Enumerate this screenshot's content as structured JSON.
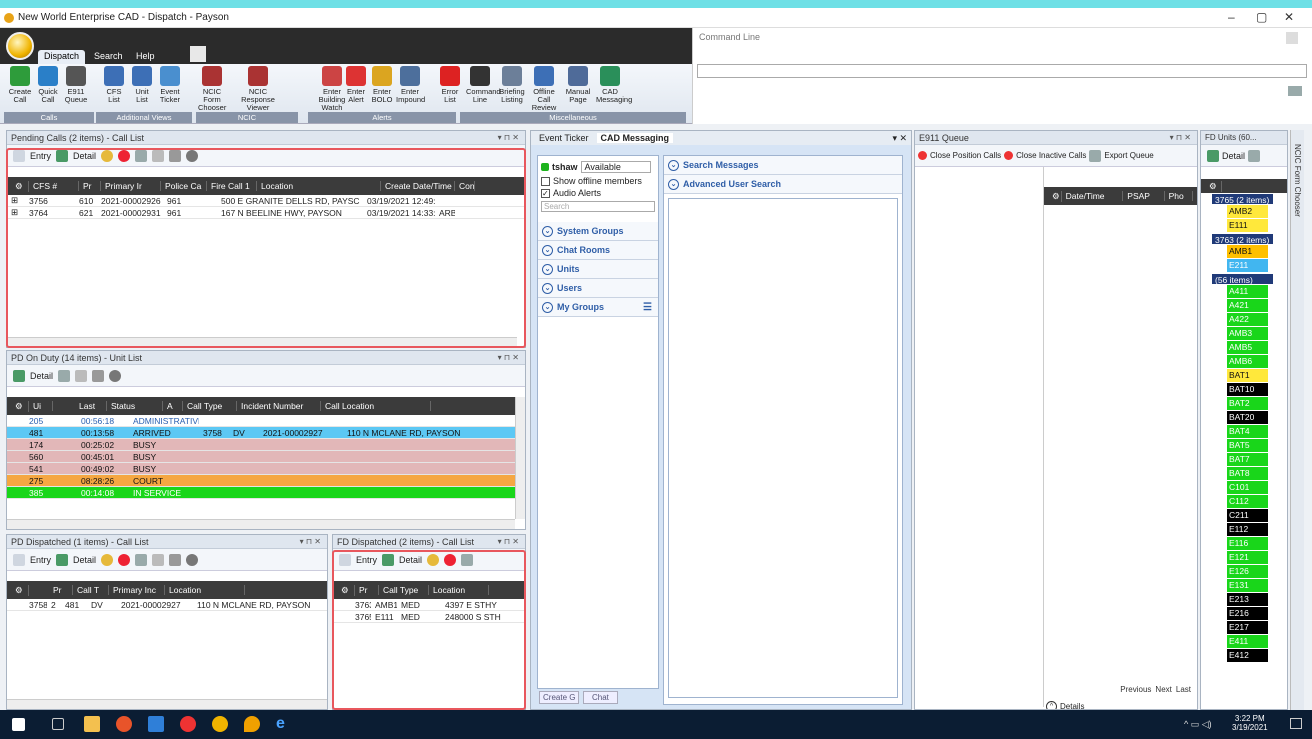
{
  "window": {
    "title": "New World Enterprise CAD - Dispatch - Payson",
    "min": "–",
    "max": "▢",
    "close": "✕"
  },
  "ribbon": {
    "tabs": [
      "Dispatch",
      "Search",
      "Help"
    ],
    "buttons": [
      {
        "label": "Create\nCall",
        "color": "#2e9c3b"
      },
      {
        "label": "Quick\nCall",
        "color": "#2a7fc8"
      },
      {
        "label": "E911\nQueue",
        "color": "#555"
      },
      {
        "label": "CFS\nList",
        "color": "#3d6fb6"
      },
      {
        "label": "Unit\nList",
        "color": "#3d6fb6"
      },
      {
        "label": "Event\nTicker",
        "color": "#4a8fcf"
      },
      {
        "label": "NCIC Form\nChooser",
        "color": "#a33"
      },
      {
        "label": "NCIC Response\nViewer",
        "color": "#a33"
      },
      {
        "label": "Enter Building\nWatch",
        "color": "#c44"
      },
      {
        "label": "Enter\nAlert",
        "color": "#d33"
      },
      {
        "label": "Enter\nBOLO",
        "color": "#dba520"
      },
      {
        "label": "Enter\nImpound",
        "color": "#4d6f9c"
      },
      {
        "label": "Error\nList",
        "color": "#d22"
      },
      {
        "label": "Command\nLine",
        "color": "#333"
      },
      {
        "label": "Briefing\nListing",
        "color": "#6c7f99"
      },
      {
        "label": "Offline Call\nReview",
        "color": "#3d6fb6"
      },
      {
        "label": "Manual\nPage",
        "color": "#4f6b99"
      },
      {
        "label": "CAD\nMessaging",
        "color": "#2a8f5a"
      }
    ],
    "groups": [
      "Calls",
      "Additional Views",
      "NCIC",
      "Alerts",
      "Miscellaneous"
    ]
  },
  "command_line": {
    "label": "Command Line"
  },
  "pending": {
    "title": "Pending Calls (2 items) - Call List",
    "toolbar": [
      "Entry",
      "Detail"
    ],
    "headers": [
      "CFS #",
      "Pr",
      "Primary Ir",
      "Police Ca",
      "Fire Call 1",
      "Location",
      "Create Date/Time",
      "Con"
    ],
    "rows": [
      [
        "3756",
        "610",
        "2021-00002926",
        "961",
        "",
        "500 E GRANITE DELLS RD, PAYSC",
        "03/19/2021 12:49:14",
        ""
      ],
      [
        "3764",
        "621",
        "2021-00002931",
        "961",
        "",
        "167 N BEELINE HWY, PAYSON",
        "03/19/2021 14:33:54",
        "ARBY"
      ]
    ]
  },
  "pd_duty": {
    "title": "PD On Duty (14 items) - Unit List",
    "toolbar": [
      "Detail"
    ],
    "headers": [
      "Ui",
      "",
      "Last",
      "Status",
      "A",
      "Call Type",
      "Incident Number",
      "Call Location"
    ],
    "rows": [
      {
        "cells": [
          "205",
          "00:56:18",
          "ADMINISTRATIVE",
          "",
          "",
          "",
          ""
        ],
        "bg": "#ffffff",
        "fg": "#2a5fb0"
      },
      {
        "cells": [
          "481",
          "00:13:58",
          "ARRIVED",
          "3758",
          "DV",
          "2021-00002927",
          "110 N MCLANE RD, PAYSON"
        ],
        "bg": "#5cc8f4",
        "fg": "#111"
      },
      {
        "cells": [
          "174",
          "00:25:02",
          "BUSY",
          "",
          "",
          "",
          ""
        ],
        "bg": "#e2b7b8",
        "fg": "#111"
      },
      {
        "cells": [
          "560",
          "00:45:01",
          "BUSY",
          "",
          "",
          "",
          ""
        ],
        "bg": "#e2b7b8",
        "fg": "#111"
      },
      {
        "cells": [
          "541",
          "00:49:02",
          "BUSY",
          "",
          "",
          "",
          ""
        ],
        "bg": "#e2b7b8",
        "fg": "#111"
      },
      {
        "cells": [
          "275",
          "08:28:26",
          "COURT",
          "",
          "",
          "",
          ""
        ],
        "bg": "#f5a742",
        "fg": "#111"
      },
      {
        "cells": [
          "385",
          "00:14:08",
          "IN SERVICE",
          "",
          "",
          "",
          ""
        ],
        "bg": "#19d61a",
        "fg": "#fff"
      }
    ]
  },
  "pd_disp": {
    "title": "PD Dispatched (1 items) - Call List",
    "toolbar": [
      "Entry",
      "Detail"
    ],
    "headers": [
      "",
      "Pr",
      "Call T",
      "Primary Inc",
      "Location"
    ],
    "rows": [
      [
        "3758",
        "2",
        "481",
        "DV",
        "2021-00002927",
        "110 N MCLANE RD, PAYSON"
      ]
    ]
  },
  "fd_disp": {
    "title": "FD Dispatched (2 items) - Call List",
    "toolbar": [
      "Entry",
      "Detail"
    ],
    "headers": [
      "Pr",
      "Call Type",
      "Location"
    ],
    "rows": [
      [
        "3763",
        "AMB1",
        "MED",
        "4397 E STHY"
      ],
      [
        "3765",
        "E111",
        "MED",
        "248000 S STH"
      ]
    ]
  },
  "center": {
    "tabs": [
      "Event Ticker",
      "CAD Messaging"
    ],
    "user": "tshaw",
    "status": "Available",
    "show_offline": "Show offline members",
    "audio_alerts": "Audio Alerts",
    "search_ph": "Search",
    "sections": [
      "System Groups",
      "Chat Rooms",
      "Units",
      "Users",
      "My Groups"
    ],
    "search_messages": "Search Messages",
    "advanced_search": "Advanced User Search",
    "btn_create": "Create G",
    "btn_chat": "Chat"
  },
  "e911": {
    "title": "E911 Queue",
    "close_pos": "Close Position Calls",
    "close_inactive": "Close Inactive Calls",
    "export": "Export Queue",
    "headers": [
      "Date/Time",
      "PSAP",
      "Pho"
    ],
    "prev": "Previous",
    "next": "Next",
    "last": "Last",
    "details": "Details"
  },
  "fd_units": {
    "title": "FD Units (60...",
    "detail": "Detail",
    "side_tab": "NCIC Form Chooser",
    "groups": [
      {
        "label": "3765 (2 items)",
        "units": [
          {
            "n": "AMB2",
            "bg": "#ffe83b",
            "fg": "#111"
          },
          {
            "n": "E111",
            "bg": "#ffe83b",
            "fg": "#111"
          }
        ]
      },
      {
        "label": "3763 (2 items)",
        "units": [
          {
            "n": "AMB1",
            "bg": "#ffc000",
            "fg": "#111"
          },
          {
            "n": "E211",
            "bg": "#41b6f0",
            "fg": "#fff"
          }
        ]
      },
      {
        "label": "(56 items)",
        "units": [
          {
            "n": "A411",
            "bg": "#19d61a",
            "fg": "#fff"
          },
          {
            "n": "A421",
            "bg": "#19d61a",
            "fg": "#fff"
          },
          {
            "n": "A422",
            "bg": "#19d61a",
            "fg": "#fff"
          },
          {
            "n": "AMB3",
            "bg": "#19d61a",
            "fg": "#fff"
          },
          {
            "n": "AMB5",
            "bg": "#19d61a",
            "fg": "#fff"
          },
          {
            "n": "AMB6",
            "bg": "#19d61a",
            "fg": "#fff"
          },
          {
            "n": "BAT1",
            "bg": "#ffe83b",
            "fg": "#111"
          },
          {
            "n": "BAT10",
            "bg": "#000",
            "fg": "#fff"
          },
          {
            "n": "BAT2",
            "bg": "#19d61a",
            "fg": "#fff"
          },
          {
            "n": "BAT20",
            "bg": "#000",
            "fg": "#fff"
          },
          {
            "n": "BAT4",
            "bg": "#19d61a",
            "fg": "#fff"
          },
          {
            "n": "BAT5",
            "bg": "#19d61a",
            "fg": "#fff"
          },
          {
            "n": "BAT7",
            "bg": "#19d61a",
            "fg": "#fff"
          },
          {
            "n": "BAT8",
            "bg": "#19d61a",
            "fg": "#fff"
          },
          {
            "n": "C101",
            "bg": "#19d61a",
            "fg": "#fff"
          },
          {
            "n": "C112",
            "bg": "#19d61a",
            "fg": "#fff"
          },
          {
            "n": "C211",
            "bg": "#000",
            "fg": "#fff"
          },
          {
            "n": "E112",
            "bg": "#000",
            "fg": "#fff"
          },
          {
            "n": "E116",
            "bg": "#19d61a",
            "fg": "#fff"
          },
          {
            "n": "E121",
            "bg": "#19d61a",
            "fg": "#fff"
          },
          {
            "n": "E126",
            "bg": "#19d61a",
            "fg": "#fff"
          },
          {
            "n": "E131",
            "bg": "#19d61a",
            "fg": "#fff"
          },
          {
            "n": "E213",
            "bg": "#000",
            "fg": "#fff"
          },
          {
            "n": "E216",
            "bg": "#000",
            "fg": "#fff"
          },
          {
            "n": "E217",
            "bg": "#000",
            "fg": "#fff"
          },
          {
            "n": "E411",
            "bg": "#19d61a",
            "fg": "#fff"
          },
          {
            "n": "E412",
            "bg": "#000",
            "fg": "#fff"
          }
        ]
      }
    ]
  },
  "taskbar": {
    "time": "3:22 PM",
    "date": "3/19/2021"
  }
}
